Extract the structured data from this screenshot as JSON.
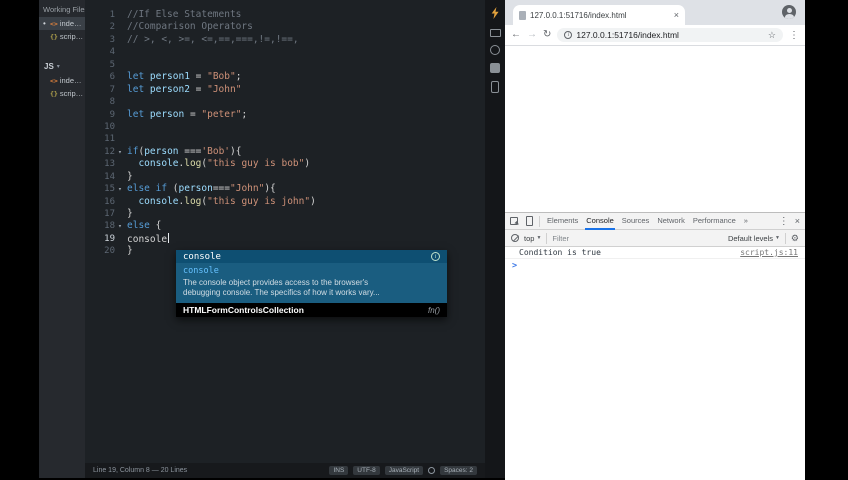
{
  "colors": {
    "keyword": "#569cd6",
    "variable": "#9cdcfe",
    "string": "#ce9178",
    "comment": "#6f7781",
    "method": "#dcdcaa",
    "plain": "#d4d4d4",
    "editor_bg": "#1d2125",
    "sidebar_bg": "#26292e",
    "statusbar_bg": "#17191c",
    "popup_selected_bg": "#0e4f72",
    "popup_doc_bg": "#1a5d80",
    "doc_link": "#66c1ff",
    "live_preview": "#e2a13c",
    "devtools_accent": "#1a73e8",
    "prompt_blue": "#3b78e7"
  },
  "editor": {
    "sidebar": {
      "working_files_header": "Working Files",
      "working_files": [
        {
          "label": "index.html",
          "type": "html",
          "glyph": "<>",
          "modified": true,
          "active": true
        },
        {
          "label": "script.js",
          "type": "js",
          "glyph": "{}",
          "modified": false,
          "active": false
        }
      ],
      "project": {
        "name": "JS",
        "caret": "▾",
        "files": [
          {
            "label": "index.html",
            "type": "html",
            "glyph": "<>"
          },
          {
            "label": "script.js",
            "type": "js",
            "glyph": "{}"
          }
        ]
      }
    },
    "toolbar_icons": [
      "live-preview-icon",
      "extension-icon-1",
      "extension-icon-2",
      "extension-icon-3",
      "extension-icon-4"
    ],
    "code": {
      "fold_glyph": "▾",
      "lines": [
        {
          "num": 1,
          "seg": [
            {
              "c": "comment",
              "t": "//If Else Statements"
            }
          ]
        },
        {
          "num": 2,
          "seg": [
            {
              "c": "comment",
              "t": "//Comparison Operators"
            }
          ]
        },
        {
          "num": 3,
          "seg": [
            {
              "c": "comment",
              "t": "// >, <, >=, <=,==,===,!=,!==,"
            }
          ]
        },
        {
          "num": 4,
          "seg": []
        },
        {
          "num": 5,
          "seg": []
        },
        {
          "num": 6,
          "seg": [
            {
              "c": "keyword",
              "t": "let "
            },
            {
              "c": "variable",
              "t": "person1"
            },
            {
              "c": "plain",
              "t": " = "
            },
            {
              "c": "string",
              "t": "\"Bob\""
            },
            {
              "c": "plain",
              "t": ";"
            }
          ]
        },
        {
          "num": 7,
          "seg": [
            {
              "c": "keyword",
              "t": "let "
            },
            {
              "c": "variable",
              "t": "person2"
            },
            {
              "c": "plain",
              "t": " = "
            },
            {
              "c": "string",
              "t": "\"John\""
            }
          ]
        },
        {
          "num": 8,
          "seg": []
        },
        {
          "num": 9,
          "seg": [
            {
              "c": "keyword",
              "t": "let "
            },
            {
              "c": "variable",
              "t": "person"
            },
            {
              "c": "plain",
              "t": " = "
            },
            {
              "c": "string",
              "t": "\"peter\""
            },
            {
              "c": "plain",
              "t": ";"
            }
          ]
        },
        {
          "num": 10,
          "seg": []
        },
        {
          "num": 11,
          "seg": []
        },
        {
          "num": 12,
          "fold": true,
          "seg": [
            {
              "c": "keyword",
              "t": "if"
            },
            {
              "c": "plain",
              "t": "("
            },
            {
              "c": "variable",
              "t": "person"
            },
            {
              "c": "plain",
              "t": " ==="
            },
            {
              "c": "string",
              "t": "'Bob'"
            },
            {
              "c": "plain",
              "t": "){"
            }
          ]
        },
        {
          "num": 13,
          "seg": [
            {
              "c": "plain",
              "t": "  "
            },
            {
              "c": "variable",
              "t": "console"
            },
            {
              "c": "plain",
              "t": "."
            },
            {
              "c": "method",
              "t": "log"
            },
            {
              "c": "plain",
              "t": "("
            },
            {
              "c": "string",
              "t": "\"this guy is bob\""
            },
            {
              "c": "plain",
              "t": ")"
            }
          ]
        },
        {
          "num": 14,
          "seg": [
            {
              "c": "plain",
              "t": "}"
            }
          ]
        },
        {
          "num": 15,
          "fold": true,
          "seg": [
            {
              "c": "keyword",
              "t": "else if"
            },
            {
              "c": "plain",
              "t": " ("
            },
            {
              "c": "variable",
              "t": "person"
            },
            {
              "c": "plain",
              "t": "==="
            },
            {
              "c": "string",
              "t": "\"John\""
            },
            {
              "c": "plain",
              "t": "){"
            }
          ]
        },
        {
          "num": 16,
          "seg": [
            {
              "c": "plain",
              "t": "  "
            },
            {
              "c": "variable",
              "t": "console"
            },
            {
              "c": "plain",
              "t": "."
            },
            {
              "c": "method",
              "t": "log"
            },
            {
              "c": "plain",
              "t": "("
            },
            {
              "c": "string",
              "t": "\"this guy is john\""
            },
            {
              "c": "plain",
              "t": ")"
            }
          ]
        },
        {
          "num": 17,
          "seg": [
            {
              "c": "plain",
              "t": "}"
            }
          ]
        },
        {
          "num": 18,
          "fold": true,
          "seg": [
            {
              "c": "keyword",
              "t": "else"
            },
            {
              "c": "plain",
              "t": " {"
            }
          ]
        },
        {
          "num": 19,
          "active": true,
          "caret": true,
          "seg": [
            {
              "c": "plain",
              "t": "console"
            }
          ]
        },
        {
          "num": 20,
          "seg": [
            {
              "c": "plain",
              "t": "}"
            }
          ]
        }
      ]
    },
    "autocomplete": {
      "selected_label": "console",
      "info_icon": "i",
      "doc_title": "console",
      "doc_lines": [
        "The console object provides access to the browser's",
        "debugging console. The specifics of how it works vary..."
      ],
      "second_label": "HTMLFormControlsCollection",
      "second_suffix": "fn()"
    },
    "statusbar": {
      "position": "Line 19, Column 8 — 20 Lines",
      "badges": [
        "INS",
        "UTF-8",
        "JavaScript"
      ],
      "spaces": "Spaces: 2"
    }
  },
  "browser": {
    "tab": {
      "title": "127.0.0.1:51716/index.html",
      "close": "×"
    },
    "nav": {
      "back": "←",
      "forward": "→",
      "reload": "↻",
      "url": "127.0.0.1:51716/index.html",
      "star": "☆",
      "menu": "⋮"
    },
    "devtools": {
      "tabs": [
        {
          "label": "Elements",
          "name": "elements"
        },
        {
          "label": "Console",
          "name": "console",
          "selected": true
        },
        {
          "label": "Sources",
          "name": "sources"
        },
        {
          "label": "Network",
          "name": "network"
        },
        {
          "label": "Performance",
          "name": "performance"
        },
        {
          "label": "»",
          "name": "more"
        }
      ],
      "menu": "⋮",
      "close": "×",
      "filter_bar": {
        "context": "top",
        "caret": "▼",
        "filter_placeholder": "Filter",
        "levels": "Default levels",
        "gear": "⚙"
      },
      "messages": [
        {
          "text": "Condition is true",
          "source": "script.js:11"
        }
      ],
      "prompt": ">"
    }
  }
}
